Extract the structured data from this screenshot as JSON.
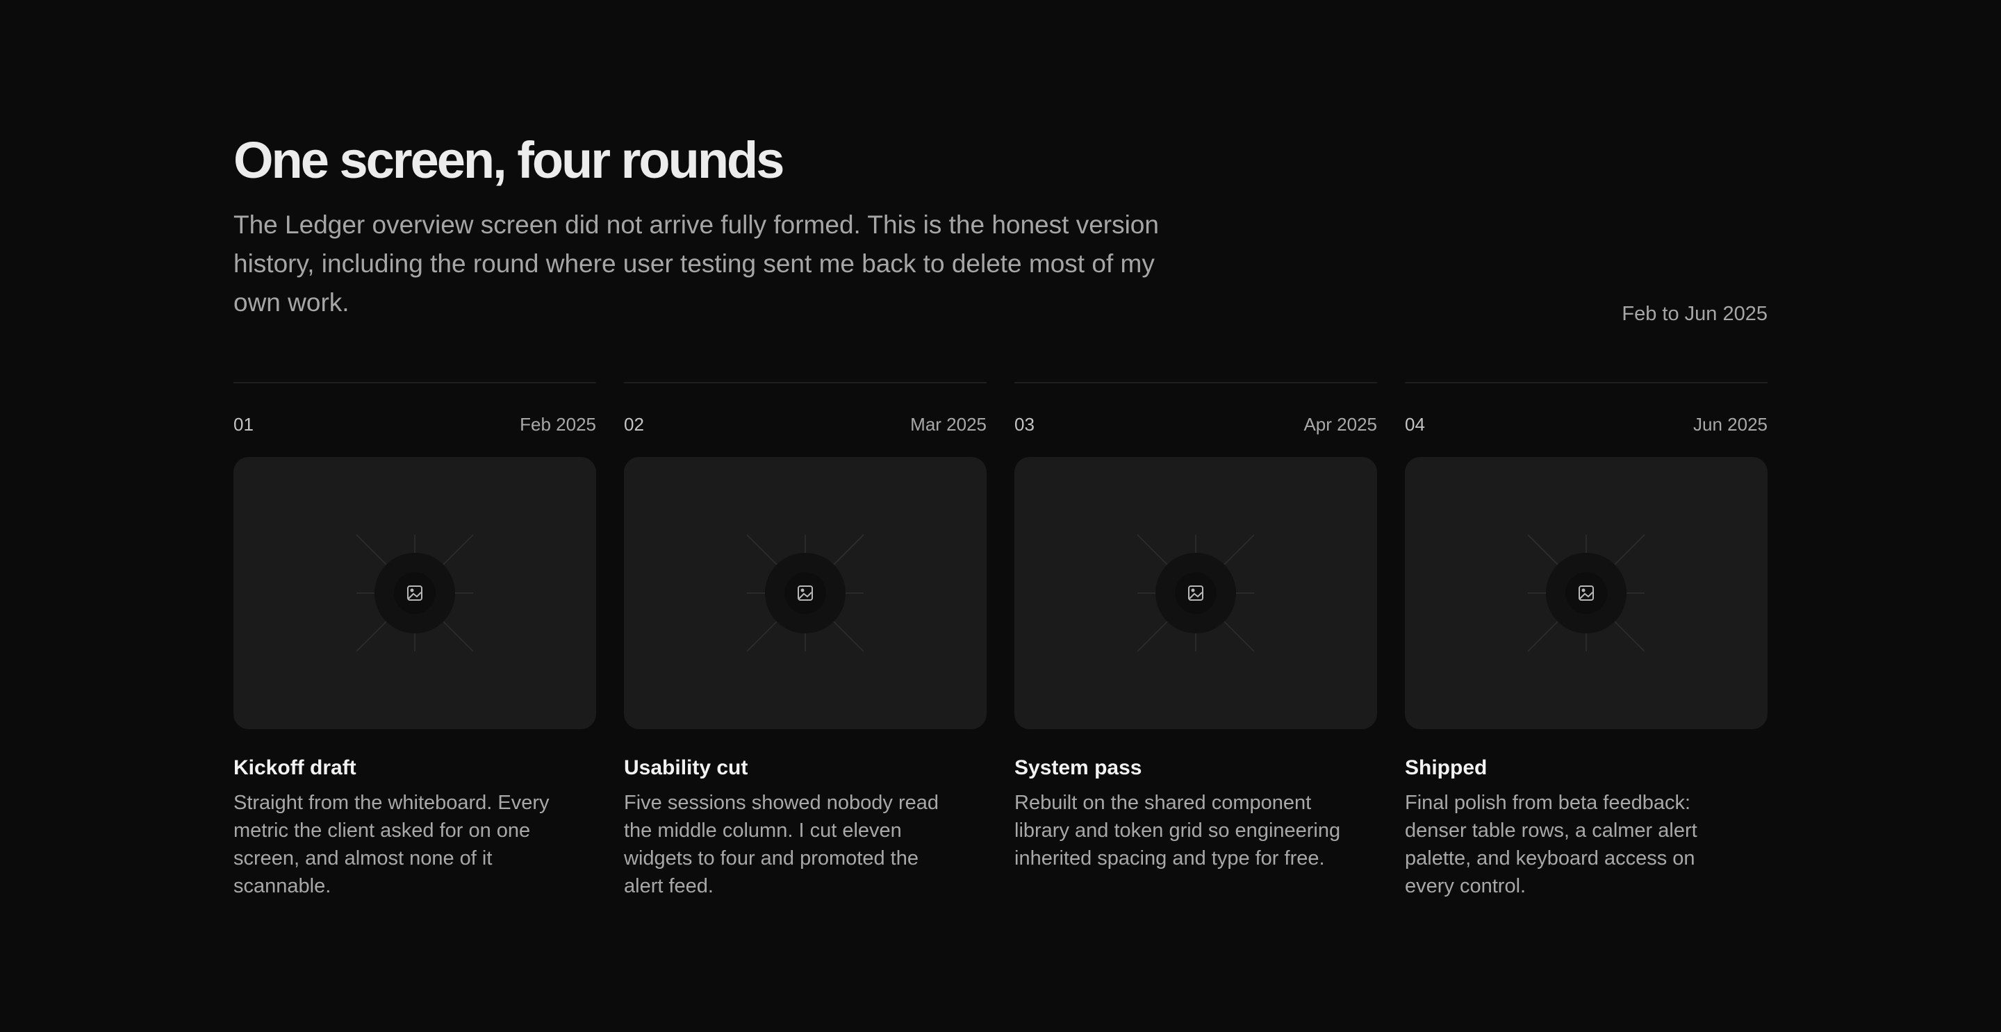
{
  "header": {
    "title": "One screen, four rounds",
    "intro": "The Ledger overview screen did not arrive fully formed. This is the honest version history, including the round where user testing sent me back to delete most of my own work.",
    "date_range": "Feb to Jun 2025"
  },
  "rounds": [
    {
      "number": "01",
      "date": "Feb 2025",
      "title": "Kickoff draft",
      "description": "Straight from the whiteboard. Every metric the client asked for on one screen, and almost none of it scannable.",
      "image_icon": "image-icon"
    },
    {
      "number": "02",
      "date": "Mar 2025",
      "title": "Usability cut",
      "description": "Five sessions showed nobody read the middle column. I cut eleven widgets to four and promoted the alert feed.",
      "image_icon": "image-icon"
    },
    {
      "number": "03",
      "date": "Apr 2025",
      "title": "System pass",
      "description": "Rebuilt on the shared component library and token grid so engineering inherited spacing and type for free.",
      "image_icon": "image-icon"
    },
    {
      "number": "04",
      "date": "Jun 2025",
      "title": "Shipped",
      "description": "Final polish from beta feedback: denser table rows, a calmer alert palette, and keyboard access on every control.",
      "image_icon": "image-icon"
    }
  ],
  "colors": {
    "background": "#0b0b0b",
    "card": "#1b1b1b",
    "title": "#ececec",
    "muted_text": "#a6a6a6"
  }
}
